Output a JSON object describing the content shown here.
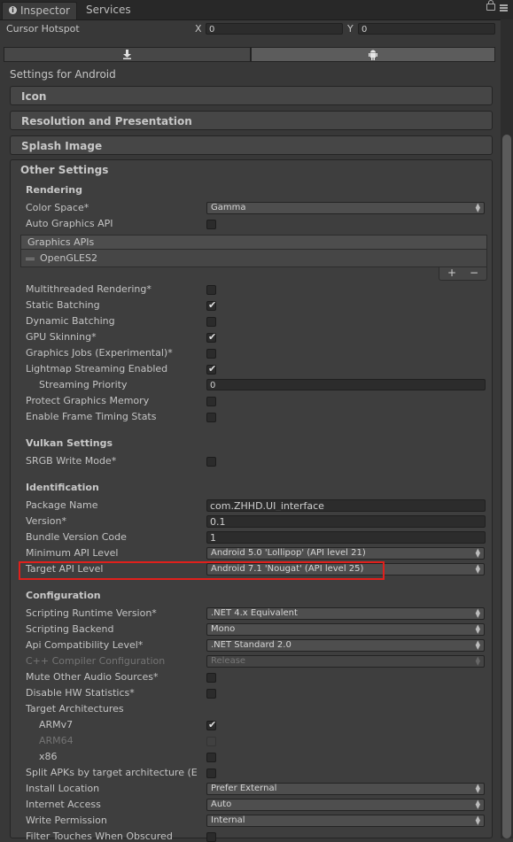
{
  "tabs": [
    {
      "label": "Inspector",
      "icon": "info-icon",
      "active": true
    },
    {
      "label": "Services",
      "active": false
    }
  ],
  "cursor_hotspot": {
    "label": "Cursor Hotspot",
    "x_label": "X",
    "x_value": "0",
    "y_label": "Y",
    "y_value": "0"
  },
  "platform_tabs": [
    {
      "icon": "download-icon",
      "active": false
    },
    {
      "icon": "android-icon",
      "active": true
    }
  ],
  "settings_title": "Settings for Android",
  "sections": {
    "icon": "Icon",
    "resolution": "Resolution and Presentation",
    "splash": "Splash Image",
    "other": "Other Settings"
  },
  "rendering": {
    "heading": "Rendering",
    "color_space": {
      "label": "Color Space*",
      "value": "Gamma"
    },
    "auto_graphics_api": {
      "label": "Auto Graphics API",
      "checked": false
    },
    "graphics_apis": {
      "header": "Graphics APIs",
      "items": [
        "OpenGLES2"
      ],
      "add": "+",
      "remove": "−"
    },
    "multithreaded": {
      "label": "Multithreaded Rendering*",
      "checked": false
    },
    "static_batching": {
      "label": "Static Batching",
      "checked": true
    },
    "dynamic_batching": {
      "label": "Dynamic Batching",
      "checked": false
    },
    "gpu_skinning": {
      "label": "GPU Skinning*",
      "checked": true
    },
    "graphics_jobs": {
      "label": "Graphics Jobs (Experimental)*",
      "checked": false
    },
    "lightmap_streaming": {
      "label": "Lightmap Streaming Enabled",
      "checked": true
    },
    "streaming_priority": {
      "label": "Streaming Priority",
      "value": "0"
    },
    "protect_memory": {
      "label": "Protect Graphics Memory",
      "checked": false
    },
    "frame_timing": {
      "label": "Enable Frame Timing Stats",
      "checked": false
    }
  },
  "vulkan": {
    "heading": "Vulkan Settings",
    "srgb": {
      "label": "SRGB Write Mode*",
      "checked": false
    }
  },
  "identification": {
    "heading": "Identification",
    "package_name": {
      "label": "Package Name",
      "value": "com.ZHHD.UI_interface"
    },
    "version": {
      "label": "Version*",
      "value": "0.1"
    },
    "bundle_code": {
      "label": "Bundle Version Code",
      "value": "1"
    },
    "min_api": {
      "label": "Minimum API Level",
      "value": "Android 5.0 'Lollipop' (API level 21)"
    },
    "target_api": {
      "label": "Target API Level",
      "value": "Android 7.1 'Nougat' (API level 25)"
    }
  },
  "configuration": {
    "heading": "Configuration",
    "runtime": {
      "label": "Scripting Runtime Version*",
      "value": ".NET 4.x Equivalent"
    },
    "backend": {
      "label": "Scripting Backend",
      "value": "Mono"
    },
    "api_compat": {
      "label": "Api Compatibility Level*",
      "value": ".NET Standard 2.0"
    },
    "cpp_config": {
      "label": "C++ Compiler Configuration",
      "value": "Release",
      "disabled": true
    },
    "mute_audio": {
      "label": "Mute Other Audio Sources*",
      "checked": false
    },
    "disable_hw": {
      "label": "Disable HW Statistics*",
      "checked": false
    },
    "target_arch": {
      "label": "Target Architectures"
    },
    "armv7": {
      "label": "ARMv7",
      "checked": true
    },
    "arm64": {
      "label": "ARM64",
      "checked": false,
      "disabled": true
    },
    "x86": {
      "label": "x86",
      "checked": false
    },
    "split_apks": {
      "label": "Split APKs by target architecture (E",
      "checked": false
    },
    "install_location": {
      "label": "Install Location",
      "value": "Prefer External"
    },
    "internet_access": {
      "label": "Internet Access",
      "value": "Auto"
    },
    "write_permission": {
      "label": "Write Permission",
      "value": "Internal"
    },
    "filter_touches": {
      "label": "Filter Touches When Obscured",
      "checked": false
    }
  },
  "colors": {
    "background": "#383838",
    "highlight": "#e0201c",
    "text": "#c4c4c4"
  }
}
